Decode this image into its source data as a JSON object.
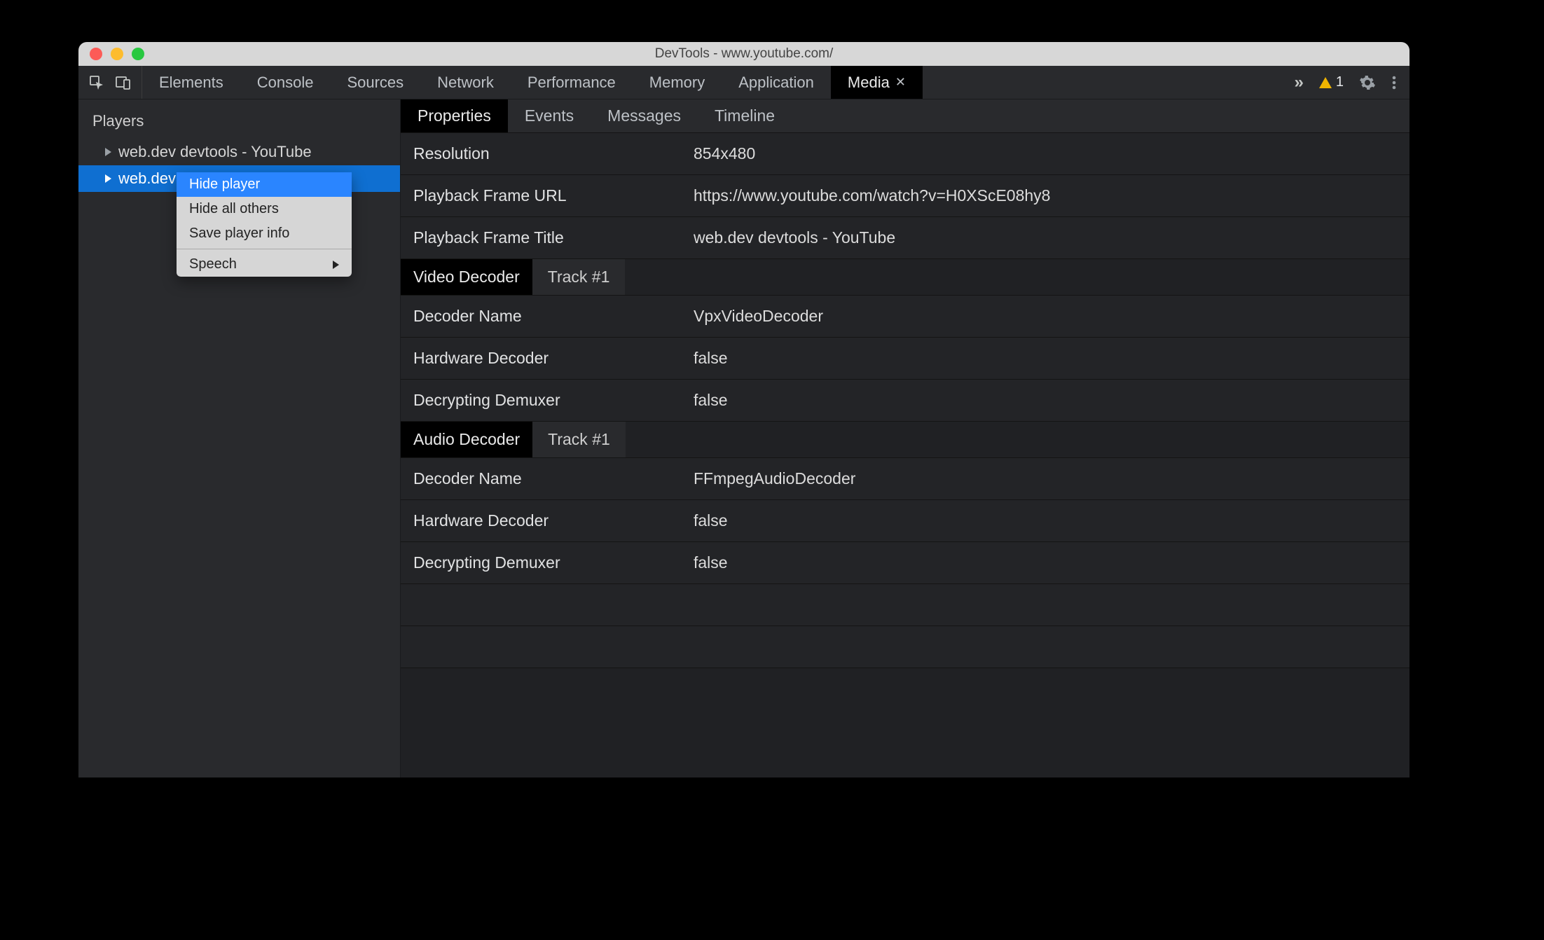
{
  "window": {
    "title": "DevTools - www.youtube.com/"
  },
  "toolbar": {
    "tabs": [
      {
        "label": "Elements"
      },
      {
        "label": "Console"
      },
      {
        "label": "Sources"
      },
      {
        "label": "Network"
      },
      {
        "label": "Performance"
      },
      {
        "label": "Memory"
      },
      {
        "label": "Application"
      },
      {
        "label": "Media",
        "active": true,
        "closeable": true
      }
    ],
    "overflow": "»",
    "warnings_count": "1"
  },
  "sidebar": {
    "header": "Players",
    "items": [
      {
        "label": "web.dev devtools - YouTube",
        "selected": false
      },
      {
        "label": "web.dev devtools - YouTube",
        "selected": true
      }
    ]
  },
  "context_menu": {
    "items": [
      {
        "label": "Hide player",
        "highlighted": true
      },
      {
        "label": "Hide all others"
      },
      {
        "label": "Save player info"
      }
    ],
    "speech_label": "Speech"
  },
  "subtabs": [
    {
      "label": "Properties",
      "active": true
    },
    {
      "label": "Events"
    },
    {
      "label": "Messages"
    },
    {
      "label": "Timeline"
    }
  ],
  "properties": {
    "general": [
      {
        "label": "Resolution",
        "value": "854x480"
      },
      {
        "label": "Playback Frame URL",
        "value": "https://www.youtube.com/watch?v=H0XScE08hy8"
      },
      {
        "label": "Playback Frame Title",
        "value": "web.dev devtools - YouTube"
      }
    ],
    "video_decoder": {
      "section": "Video Decoder",
      "track": "Track #1",
      "rows": [
        {
          "label": "Decoder Name",
          "value": "VpxVideoDecoder"
        },
        {
          "label": "Hardware Decoder",
          "value": "false"
        },
        {
          "label": "Decrypting Demuxer",
          "value": "false"
        }
      ]
    },
    "audio_decoder": {
      "section": "Audio Decoder",
      "track": "Track #1",
      "rows": [
        {
          "label": "Decoder Name",
          "value": "FFmpegAudioDecoder"
        },
        {
          "label": "Hardware Decoder",
          "value": "false"
        },
        {
          "label": "Decrypting Demuxer",
          "value": "false"
        }
      ]
    }
  }
}
